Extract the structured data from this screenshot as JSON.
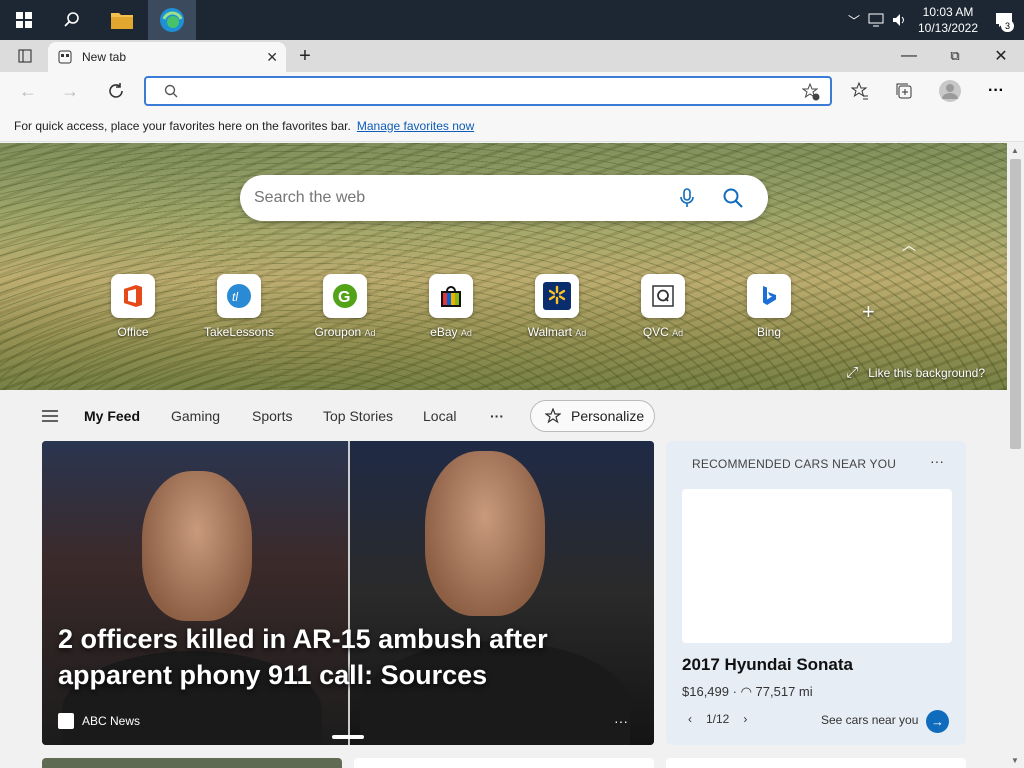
{
  "taskbar": {
    "time": "10:03 AM",
    "date": "10/13/2022",
    "notification_count": "3"
  },
  "browser": {
    "tab_title": "New tab",
    "address_value": "",
    "favorites_prompt": "For quick access, place your favorites here on the favorites bar.",
    "favorites_link": "Manage favorites now"
  },
  "newtab": {
    "search_placeholder": "Search the web",
    "quick_links": [
      {
        "label": "Office",
        "ad": ""
      },
      {
        "label": "TakeLessons",
        "ad": ""
      },
      {
        "label": "Groupon",
        "ad": "Ad"
      },
      {
        "label": "eBay",
        "ad": "Ad"
      },
      {
        "label": "Walmart",
        "ad": "Ad"
      },
      {
        "label": "QVC",
        "ad": "Ad"
      },
      {
        "label": "Bing",
        "ad": ""
      }
    ],
    "like_background": "Like this background?"
  },
  "feed": {
    "tabs": [
      "My Feed",
      "Gaming",
      "Sports",
      "Top Stories",
      "Local"
    ],
    "more": "···",
    "personalize": "Personalize"
  },
  "hero_story": {
    "headline": "2 officers killed in AR-15 ambush after apparent phony 911 call: Sources",
    "source": "ABC News",
    "more": "···"
  },
  "cars_card": {
    "title": "RECOMMENDED CARS NEAR YOU",
    "more": "···",
    "car_name": "2017 Hyundai Sonata",
    "price": "$16,499",
    "mileage": "77,517 mi",
    "pager": "1/12",
    "link": "See cars near you"
  },
  "colors": {
    "taskbar": "#1c2733",
    "accent": "#0f6cbd",
    "address_border": "#3a7bd5"
  }
}
